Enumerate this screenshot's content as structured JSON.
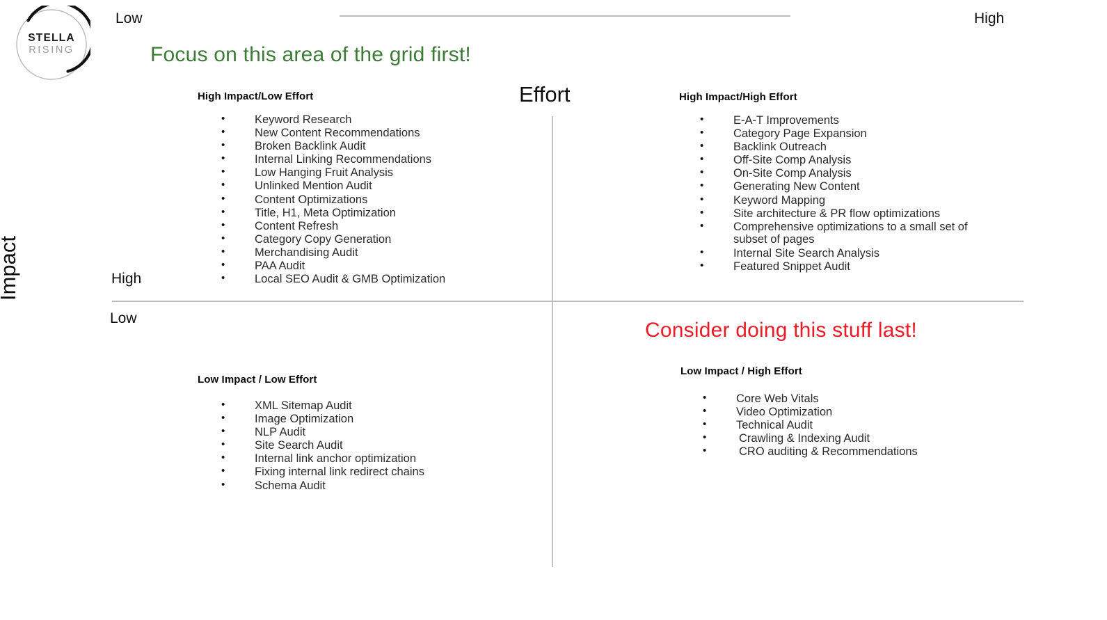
{
  "logo": {
    "name": "stella-rising-logo",
    "line1": "STELLA",
    "line2": "RISING"
  },
  "axes": {
    "effort": {
      "title": "Effort",
      "low_label": "Low",
      "high_label": "High"
    },
    "impact": {
      "title": "Impact",
      "high_label": "High",
      "low_label": "Low"
    }
  },
  "callouts": {
    "focus": {
      "text": "Focus on this area of the grid first!",
      "color": "#3d7a37"
    },
    "last": {
      "text": "Consider doing this stuff last!",
      "color": "#ec1c26"
    }
  },
  "quadrants": {
    "high_impact_low_effort": {
      "title": "High Impact/Low Effort",
      "items": [
        "Keyword Research",
        "New Content Recommendations",
        "Broken Backlink Audit",
        "Internal Linking Recommendations",
        "Low Hanging Fruit Analysis",
        "Unlinked Mention Audit",
        "Content Optimizations",
        "Title, H1, Meta Optimization",
        "Content Refresh",
        "Category Copy Generation",
        "Merchandising Audit",
        "PAA Audit",
        "Local SEO Audit & GMB Optimization"
      ]
    },
    "high_impact_high_effort": {
      "title": "High Impact/High Effort",
      "items": [
        "E-A-T Improvements",
        "Category Page Expansion",
        "Backlink Outreach",
        "Off-Site Comp Analysis",
        "On-Site Comp Analysis",
        "Generating New Content",
        "Keyword Mapping",
        "Site architecture & PR flow optimizations",
        "Comprehensive optimizations to a small set of subset of pages",
        "Internal Site Search Analysis",
        "Featured Snippet Audit"
      ]
    },
    "low_impact_low_effort": {
      "title": "Low Impact / Low Effort",
      "items": [
        "XML Sitemap Audit",
        "Image Optimization",
        "NLP Audit",
        "Site Search Audit",
        "Internal link anchor optimization",
        "Fixing internal link redirect chains",
        "Schema Audit"
      ]
    },
    "low_impact_high_effort": {
      "title": "Low Impact / High Effort",
      "items": [
        "Core Web Vitals",
        "Video Optimization",
        "Technical Audit",
        "Crawling & Indexing Audit",
        "CRO auditing & Recommendations"
      ]
    }
  }
}
